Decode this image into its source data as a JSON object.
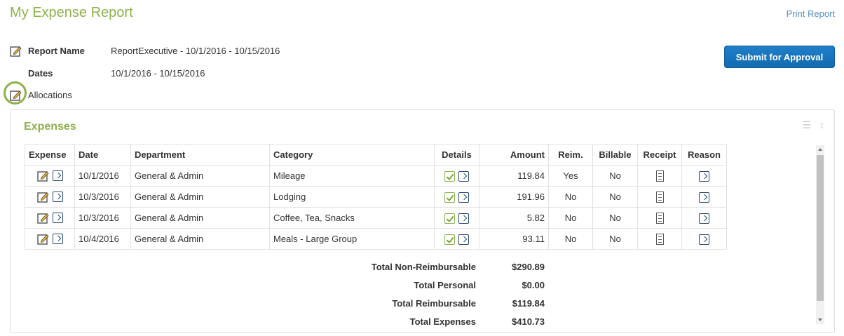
{
  "header": {
    "title": "My Expense Report",
    "print_label": "Print Report",
    "submit_label": "Submit for Approval"
  },
  "report_info": {
    "report_name_label": "Report Name",
    "report_name_value": "ReportExecutive - 10/1/2016 - 10/15/2016",
    "dates_label": "Dates",
    "dates_value": "10/1/2016 - 10/15/2016",
    "allocations_label": "Allocations"
  },
  "expenses": {
    "title": "Expenses",
    "columns": [
      "Expense",
      "Date",
      "Department",
      "Category",
      "Details",
      "Amount",
      "Reim.",
      "Billable",
      "Receipt",
      "Reason"
    ],
    "rows": [
      {
        "date": "10/1/2016",
        "department": "General & Admin",
        "category": "Mileage",
        "amount": "119.84",
        "reim": "Yes",
        "billable": "No"
      },
      {
        "date": "10/3/2016",
        "department": "General & Admin",
        "category": "Lodging",
        "amount": "191.96",
        "reim": "No",
        "billable": "No"
      },
      {
        "date": "10/3/2016",
        "department": "General & Admin",
        "category": "Coffee, Tea, Snacks",
        "amount": "5.82",
        "reim": "No",
        "billable": "No"
      },
      {
        "date": "10/4/2016",
        "department": "General & Admin",
        "category": "Meals - Large Group",
        "amount": "93.11",
        "reim": "No",
        "billable": "No"
      }
    ],
    "totals": [
      {
        "label": "Total Non-Reimbursable",
        "value": "$290.89"
      },
      {
        "label": "Total Personal",
        "value": "$0.00"
      },
      {
        "label": "Total Reimbursable",
        "value": "$119.84"
      },
      {
        "label": "Total Expenses",
        "value": "$410.73"
      }
    ]
  },
  "icons": {
    "edit": "pencil-edit-icon",
    "nav": "chevron-right-icon",
    "details": "checkbox-icon",
    "receipt": "receipt-icon",
    "list_view": "list-icon",
    "sort": "sort-arrows-icon"
  },
  "colors": {
    "accent_green": "#8db24a",
    "button_blue": "#1a74bd",
    "link_blue": "#5a8ec4"
  }
}
